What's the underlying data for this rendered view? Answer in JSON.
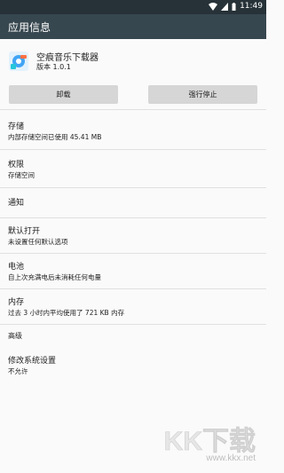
{
  "status_bar": {
    "time": "11:49"
  },
  "app_bar": {
    "title": "应用信息"
  },
  "app": {
    "name": "空痕音乐下载器",
    "version": "版本 1.0.1"
  },
  "buttons": {
    "uninstall": "卸载",
    "force_stop": "强行停止"
  },
  "sections": {
    "storage": {
      "label": "存储",
      "value": "内部存储空间已使用 45.41 MB"
    },
    "permissions": {
      "label": "权限",
      "value": "存储空间"
    },
    "notifications": {
      "label": "通知"
    },
    "open_by_default": {
      "label": "默认打开",
      "value": "未设置任何默认选项"
    },
    "battery": {
      "label": "电池",
      "value": "自上次充满电后未消耗任何电量"
    },
    "memory": {
      "label": "内存",
      "value": "过去 3 小时内平均使用了 721 KB 内存"
    },
    "advanced": {
      "label": "高级"
    },
    "modify_settings": {
      "label": "修改系统设置",
      "value": "不允许"
    }
  },
  "watermark": {
    "main": "KK下载",
    "url": "www.kkx.net"
  },
  "colors": {
    "status_bar": "#263238",
    "app_bar": "#37474f",
    "button": "#d6d6d6",
    "watermark": "#e6e6e6"
  }
}
